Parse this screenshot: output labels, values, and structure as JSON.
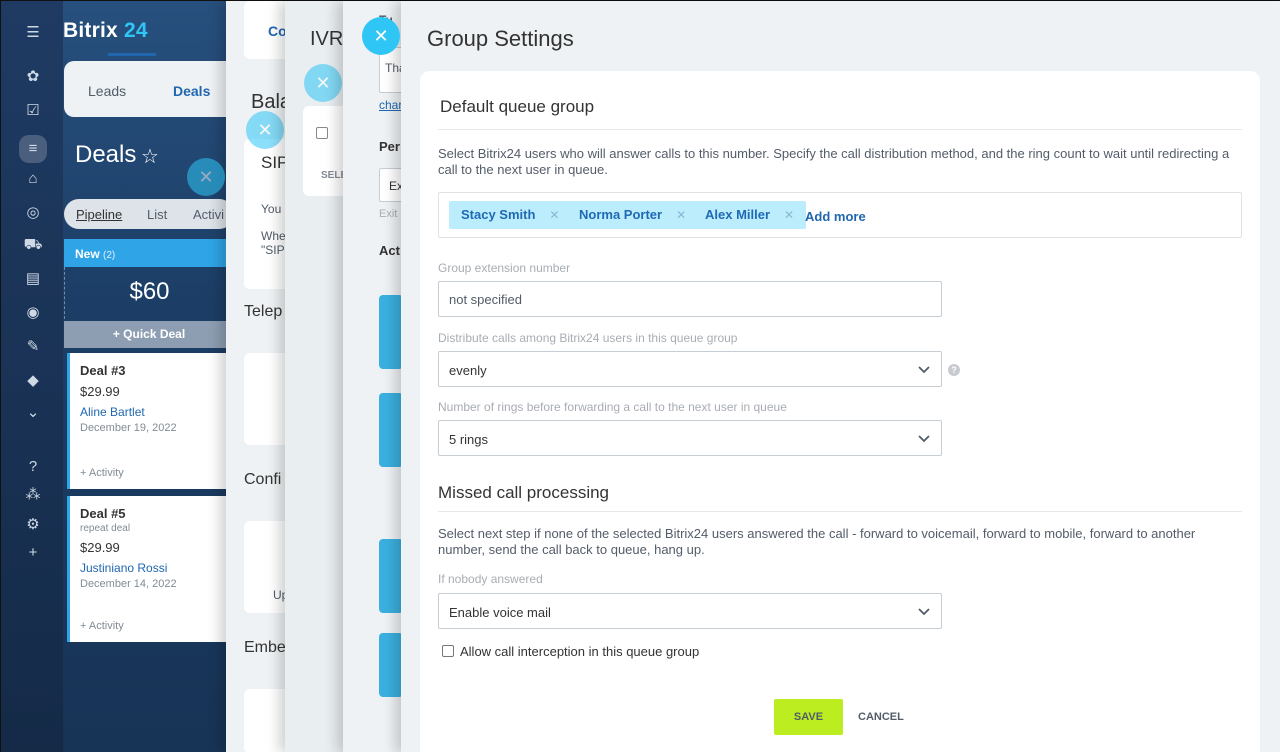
{
  "brand": {
    "name": "Bitrix",
    "number": "24"
  },
  "sidebar_icons": [
    "menu-icon",
    "feed-icon",
    "tasks-icon",
    "crm-icon",
    "bank-icon",
    "target-icon",
    "cart-icon",
    "contacts-icon",
    "robot-icon",
    "sign-icon",
    "box-icon",
    "more-icon",
    "help-icon",
    "structure-icon",
    "settings-icon",
    "plus-icon"
  ],
  "crm": {
    "tabs": [
      "Leads",
      "Deals"
    ],
    "title": "Deals",
    "views": [
      "Pipeline",
      "List",
      "Activi"
    ],
    "stage": {
      "name": "New",
      "count": "(2)",
      "sum": "$60"
    },
    "quick_deal": "Quick Deal",
    "deals": [
      {
        "title": "Deal #3",
        "subtitle": "",
        "price": "$29.99",
        "client": "Aline Bartlet",
        "date": "December 19, 2022",
        "activity": "+ Activity"
      },
      {
        "title": "Deal #5",
        "subtitle": "repeat deal",
        "price": "$29.99",
        "client": "Justiniano Rossi",
        "date": "December 14, 2022",
        "activity": "+ Activity"
      }
    ]
  },
  "bg_panels": {
    "p1": {
      "tab": "Co",
      "heading": "Bala",
      "sip": "SIP",
      "you": "You",
      "whe": "Whe",
      "sip_quote": "\"SIP",
      "tele": "Telep",
      "conf": "Confi",
      "emb": "Embe",
      "up": "Up"
    },
    "p2": {
      "title": "IVR",
      "sele": "SELE"
    },
    "p3": {
      "tu": "Tu",
      "tha": "Tha",
      "char": "char",
      "per": "Per",
      "ex": "Ex",
      "exit": "Exit",
      "act": "Act"
    }
  },
  "dialog": {
    "title": "Group Settings",
    "section1_title": "Default queue group",
    "section1_desc": "Select Bitrix24 users who will answer calls to this number. Specify the call distribution method, and the ring count to wait until redirecting a call to the next user in queue.",
    "users": [
      "Stacy Smith",
      "Norma Porter",
      "Alex Miller"
    ],
    "add_more": "Add more",
    "ext_label": "Group extension number",
    "ext_placeholder": "not specified",
    "distribute_label": "Distribute calls among Bitrix24 users in this queue group",
    "distribute_value": "evenly",
    "help": "?",
    "rings_label": "Number of rings before forwarding a call to the next user in queue",
    "rings_value": "5 rings",
    "section2_title": "Missed call processing",
    "section2_desc": "Select next step if none of the selected Bitrix24 users answered the call - forward to voicemail, forward to mobile, forward to another number, send the call back to queue, hang up.",
    "nobody_label": "If nobody answered",
    "nobody_value": "Enable voice mail",
    "intercept_label": "Allow call interception in this queue group",
    "save": "SAVE",
    "cancel": "CANCEL"
  },
  "colors": {
    "accent": "#2fc6f6",
    "save": "#bbed21",
    "chip": "#bcedfc",
    "link": "#2067b0"
  }
}
